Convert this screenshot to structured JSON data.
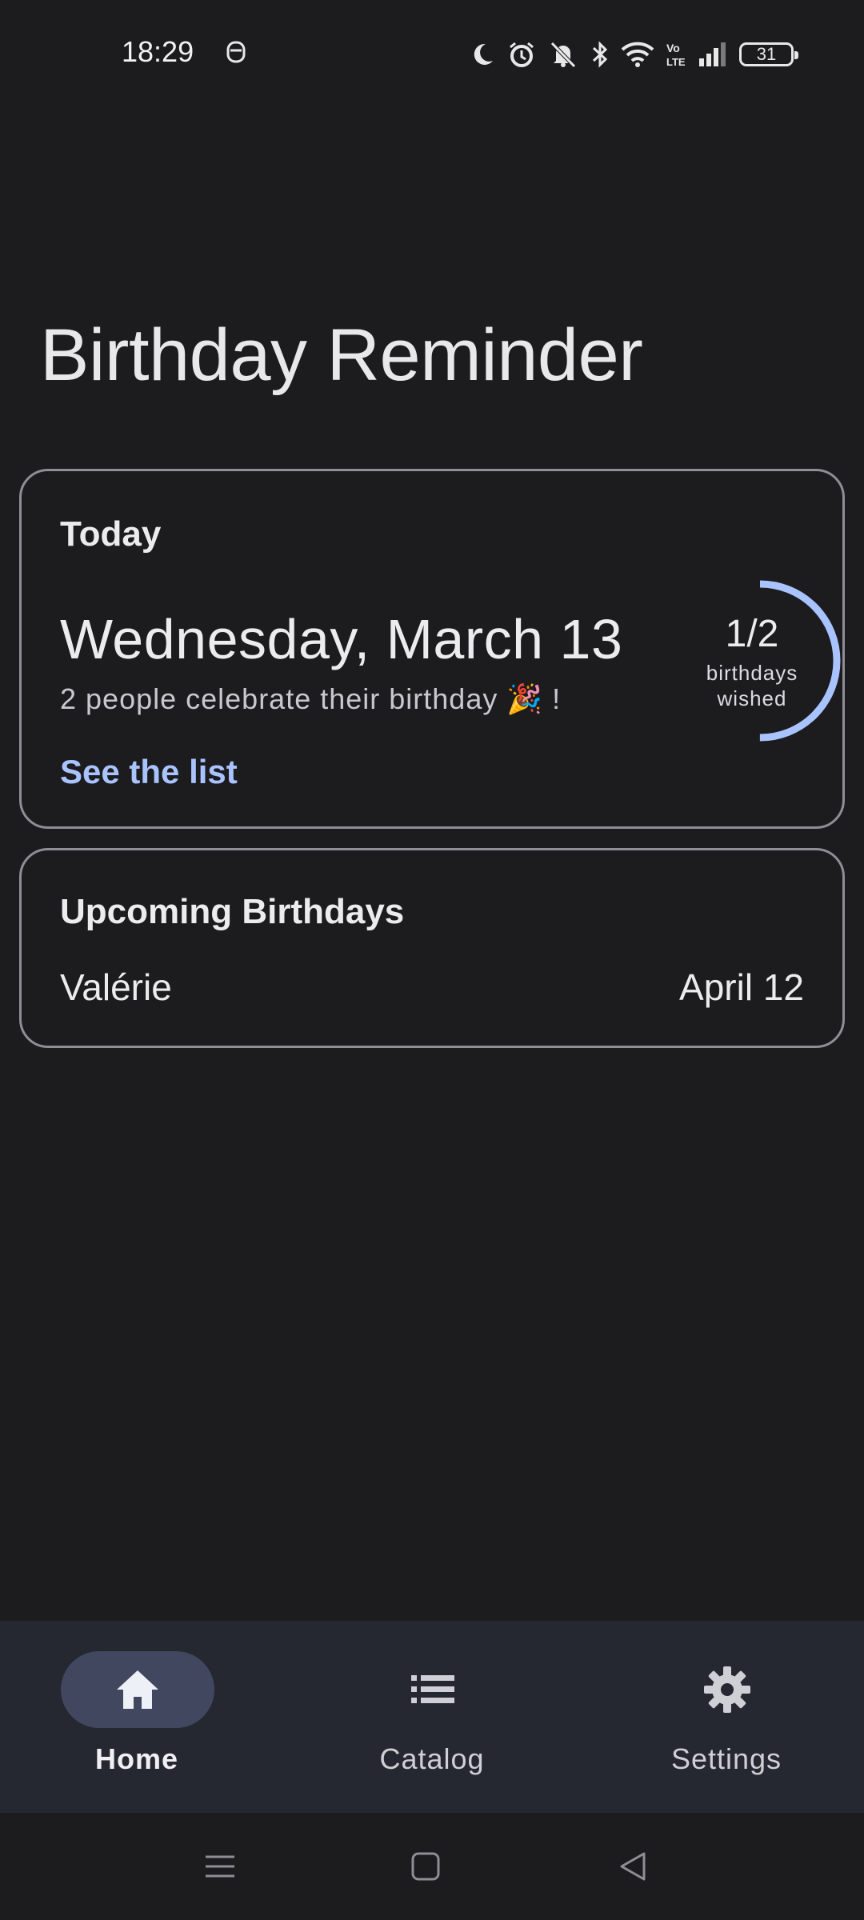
{
  "status_bar": {
    "time": "18:29",
    "battery": "31",
    "icons": [
      "moon-icon",
      "alarm-icon",
      "silent-icon",
      "bluetooth-icon",
      "wifi-icon",
      "volte-icon",
      "signal-icon",
      "battery-icon"
    ]
  },
  "app": {
    "title": "Birthday Reminder"
  },
  "today": {
    "heading": "Today",
    "date": "Wednesday, March 13",
    "subtitle": "2 people celebrate their birthday 🎉 !",
    "link": "See the list",
    "progress": {
      "wished": 1,
      "total": 2,
      "count_text": "1/2",
      "label_line1": "birthdays",
      "label_line2": "wished",
      "fraction": 0.5,
      "color": "#a9c3ff"
    }
  },
  "upcoming": {
    "heading": "Upcoming Birthdays",
    "items": [
      {
        "name": "Valérie",
        "date": "April 12"
      }
    ]
  },
  "bottom_nav": {
    "items": [
      {
        "label": "Home",
        "icon": "home-icon",
        "active": true
      },
      {
        "label": "Catalog",
        "icon": "list-icon",
        "active": false
      },
      {
        "label": "Settings",
        "icon": "gear-icon",
        "active": false
      }
    ]
  },
  "system_nav": {
    "buttons": [
      "menu-icon",
      "home-square-icon",
      "back-icon"
    ]
  }
}
